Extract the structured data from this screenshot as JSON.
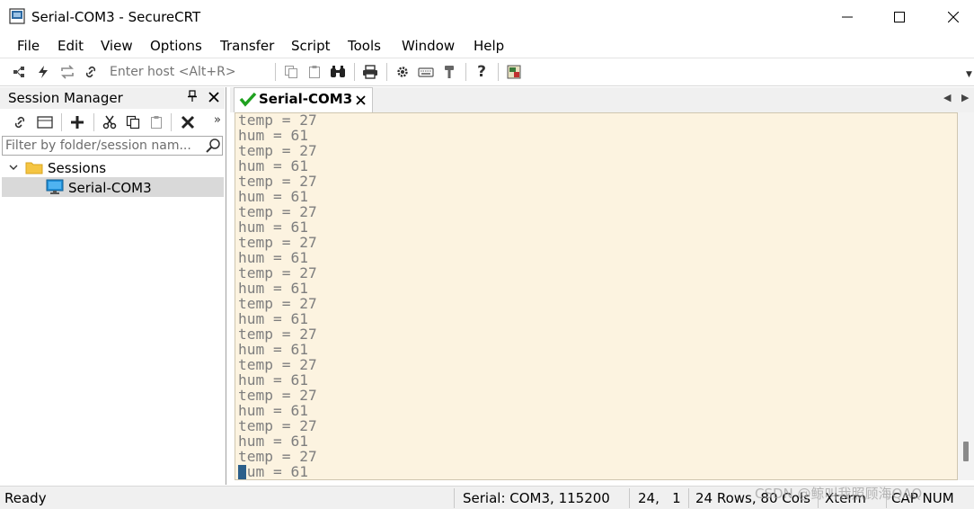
{
  "window": {
    "title": "Serial-COM3 - SecureCRT"
  },
  "menu": {
    "items": [
      "File",
      "Edit",
      "View",
      "Options",
      "Transfer",
      "Script",
      "Tools",
      "Window",
      "Help"
    ]
  },
  "toolbar": {
    "host_placeholder": "Enter host <Alt+R>",
    "icons": [
      "connect-bar-icon",
      "quick-connect-icon",
      "reconnect-icon",
      "connect-in-tab-icon",
      "copy-icon",
      "paste-icon",
      "find-icon",
      "print-icon",
      "settings-icon",
      "keymap-icon",
      "key-agent-icon",
      "help-icon",
      "sftp-icon"
    ]
  },
  "session_manager": {
    "title": "Session Manager",
    "filter_placeholder": "Filter by folder/session nam...",
    "tree": {
      "folder": "Sessions",
      "sessions": [
        "Serial-COM3"
      ]
    }
  },
  "tab": {
    "label": "Serial-COM3"
  },
  "terminal": {
    "lines": [
      "temp = 27",
      "hum = 61",
      "temp = 27",
      "hum = 61",
      "temp = 27",
      "hum = 61",
      "temp = 27",
      "hum = 61",
      "temp = 27",
      "hum = 61",
      "temp = 27",
      "hum = 61",
      "temp = 27",
      "hum = 61",
      "temp = 27",
      "hum = 61",
      "temp = 27",
      "hum = 61",
      "temp = 27",
      "hum = 61",
      "temp = 27",
      "hum = 61",
      "temp = 27",
      "hum = 61",
      "temp = 27"
    ]
  },
  "status": {
    "ready": "Ready",
    "connection": "Serial: COM3, 115200",
    "cursor_pos": "24,   1",
    "rows_cols": "24 Rows, 80 Cols",
    "term_type": "Xterm",
    "caps_num": "CAP NUM"
  },
  "watermark": "CSDN @鲸叫我照顾海QAQ",
  "colors": {
    "terminal_bg": "#fcf3e0",
    "terminal_fg": "#7e7e7e",
    "connected_check": "#1fa11f",
    "selection": "#d9d9d9"
  }
}
